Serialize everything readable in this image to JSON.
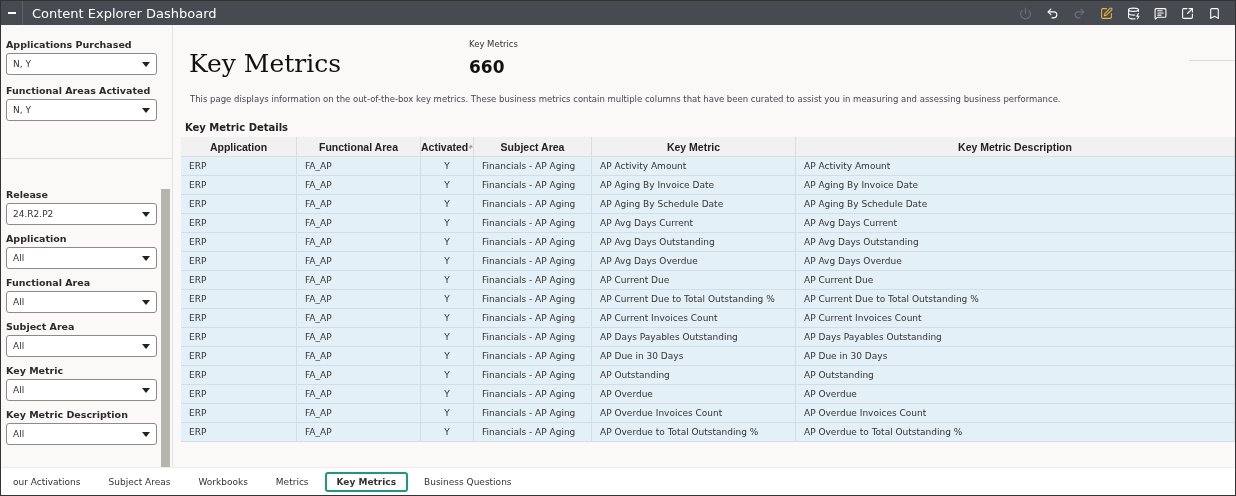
{
  "window": {
    "title": "Content Explorer Dashboard"
  },
  "toolbar": [
    {
      "kind": "power",
      "disabled": true
    },
    {
      "kind": "undo",
      "disabled": false
    },
    {
      "kind": "redo",
      "disabled": true
    },
    {
      "kind": "edit",
      "disabled": false
    },
    {
      "kind": "refresh-data",
      "disabled": false
    },
    {
      "kind": "comment",
      "disabled": false
    },
    {
      "kind": "export",
      "disabled": false
    },
    {
      "kind": "bookmark",
      "disabled": false
    }
  ],
  "top_filters": [
    {
      "label": "Applications Purchased",
      "value": "N, Y"
    },
    {
      "label": "Functional Areas Activated",
      "value": "N, Y"
    }
  ],
  "filters": [
    {
      "label": "Release",
      "value": "24.R2.P2"
    },
    {
      "label": "Application",
      "value": "All"
    },
    {
      "label": "Functional Area",
      "value": "All"
    },
    {
      "label": "Subject Area",
      "value": "All"
    },
    {
      "label": "Key Metric",
      "value": "All"
    },
    {
      "label": "Key Metric Description",
      "value": "All"
    }
  ],
  "heading": "Key Metrics",
  "kpi": {
    "label": "Key Metrics",
    "value": "660"
  },
  "description": "This page displays information on the out-of-the-box key metrics. These business metrics contain multiple columns that have been curated to assist you in measuring and assessing business performance.",
  "table": {
    "title": "Key Metric Details",
    "columns": [
      {
        "label": "Application",
        "sortable": false
      },
      {
        "label": "Functional Area",
        "sortable": false
      },
      {
        "label": "Activated",
        "sortable": true
      },
      {
        "label": "Subject Area",
        "sortable": false
      },
      {
        "label": "Key Metric",
        "sortable": false
      },
      {
        "label": "Key Metric Description",
        "sortable": false
      }
    ],
    "rows": [
      [
        "ERP",
        "FA_AP",
        "Y",
        "Financials - AP Aging",
        "AP Activity Amount",
        "AP Activity Amount"
      ],
      [
        "ERP",
        "FA_AP",
        "Y",
        "Financials - AP Aging",
        "AP Aging By Invoice Date",
        "AP Aging By Invoice Date"
      ],
      [
        "ERP",
        "FA_AP",
        "Y",
        "Financials - AP Aging",
        "AP Aging By Schedule Date",
        "AP Aging By Schedule Date"
      ],
      [
        "ERP",
        "FA_AP",
        "Y",
        "Financials - AP Aging",
        "AP Avg Days Current",
        "AP Avg Days Current"
      ],
      [
        "ERP",
        "FA_AP",
        "Y",
        "Financials - AP Aging",
        "AP Avg Days Outstanding",
        "AP Avg Days Outstanding"
      ],
      [
        "ERP",
        "FA_AP",
        "Y",
        "Financials - AP Aging",
        "AP Avg Days Overdue",
        "AP Avg Days Overdue"
      ],
      [
        "ERP",
        "FA_AP",
        "Y",
        "Financials - AP Aging",
        "AP Current Due",
        "AP Current Due"
      ],
      [
        "ERP",
        "FA_AP",
        "Y",
        "Financials - AP Aging",
        "AP Current Due to Total Outstanding %",
        "AP Current Due to Total Outstanding %"
      ],
      [
        "ERP",
        "FA_AP",
        "Y",
        "Financials - AP Aging",
        "AP Current Invoices Count",
        "AP Current Invoices Count"
      ],
      [
        "ERP",
        "FA_AP",
        "Y",
        "Financials - AP Aging",
        "AP Days Payables Outstanding",
        "AP Days Payables Outstanding"
      ],
      [
        "ERP",
        "FA_AP",
        "Y",
        "Financials - AP Aging",
        "AP Due in 30 Days",
        "AP Due in 30 Days"
      ],
      [
        "ERP",
        "FA_AP",
        "Y",
        "Financials - AP Aging",
        "AP Outstanding",
        "AP Outstanding"
      ],
      [
        "ERP",
        "FA_AP",
        "Y",
        "Financials - AP Aging",
        "AP Overdue",
        "AP Overdue"
      ],
      [
        "ERP",
        "FA_AP",
        "Y",
        "Financials - AP Aging",
        "AP Overdue Invoices Count",
        "AP Overdue Invoices Count"
      ],
      [
        "ERP",
        "FA_AP",
        "Y",
        "Financials - AP Aging",
        "AP Overdue to Total Outstanding %",
        "AP Overdue to Total Outstanding %"
      ]
    ]
  },
  "tabs": [
    {
      "label": "our Activations",
      "selected": false
    },
    {
      "label": "Subject Areas",
      "selected": false
    },
    {
      "label": "Workbooks",
      "selected": false
    },
    {
      "label": "Metrics",
      "selected": false
    },
    {
      "label": "Key Metrics",
      "selected": true
    },
    {
      "label": "Business Questions",
      "selected": false
    }
  ]
}
